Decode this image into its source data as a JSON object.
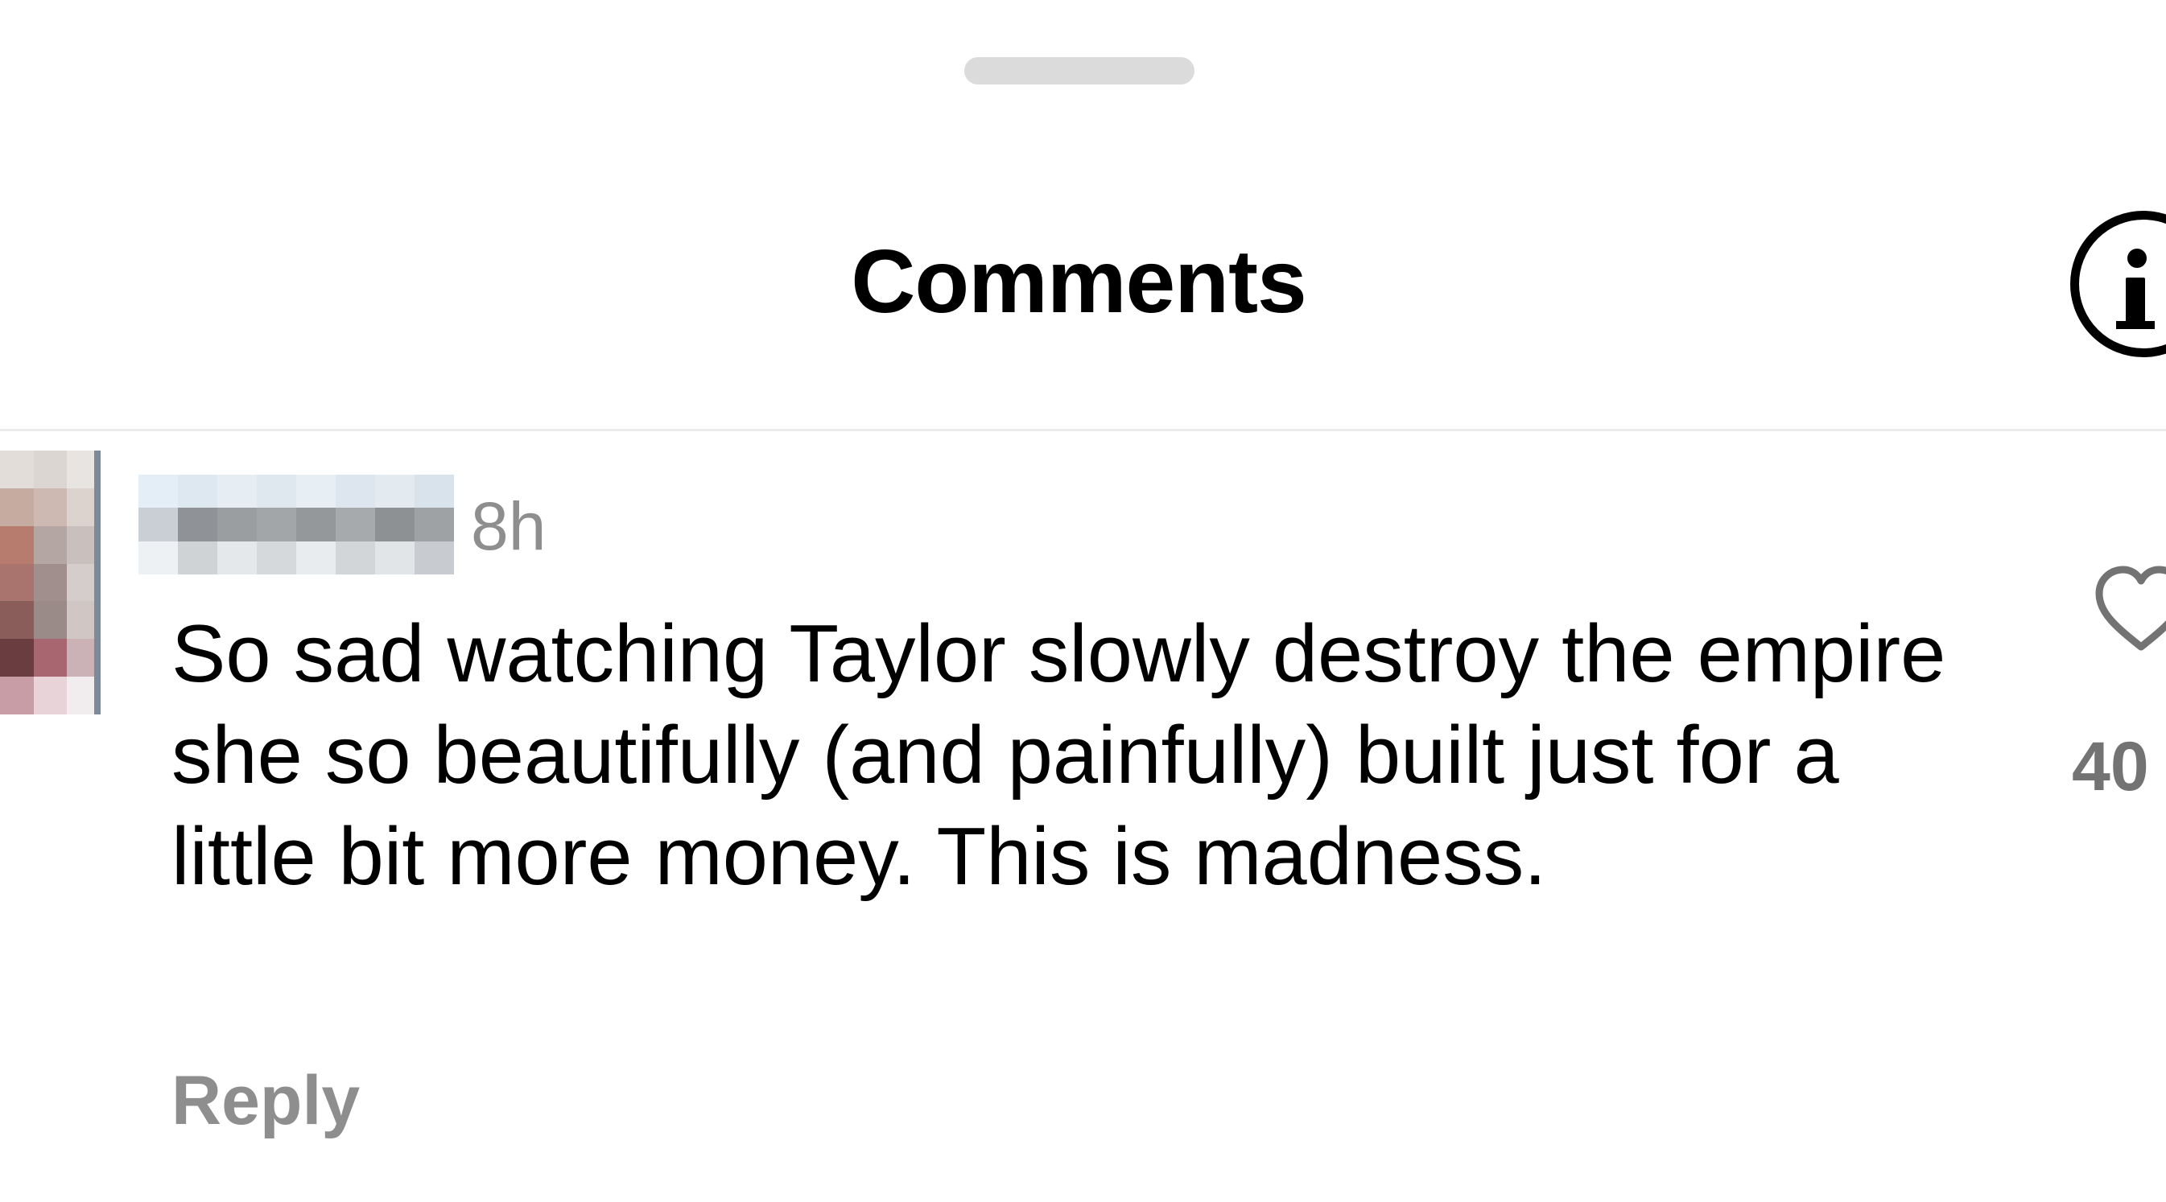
{
  "sheet": {
    "title": "Comments",
    "info_icon": "info-icon",
    "handle_icon": "drag-handle"
  },
  "comment": {
    "avatar_icon": "avatar",
    "timestamp": "8h",
    "text": "So sad watching Taylor slowly destroy the empire she so beautifully (and painfully) built just for a little bit more money. This is madness.",
    "reply_label": "Reply",
    "like_icon": "heart-icon",
    "like_count": "40"
  },
  "colors": {
    "text_primary": "#000000",
    "text_secondary": "#8e8e8e",
    "divider": "#ebebeb",
    "handle": "#dbdbdb"
  }
}
